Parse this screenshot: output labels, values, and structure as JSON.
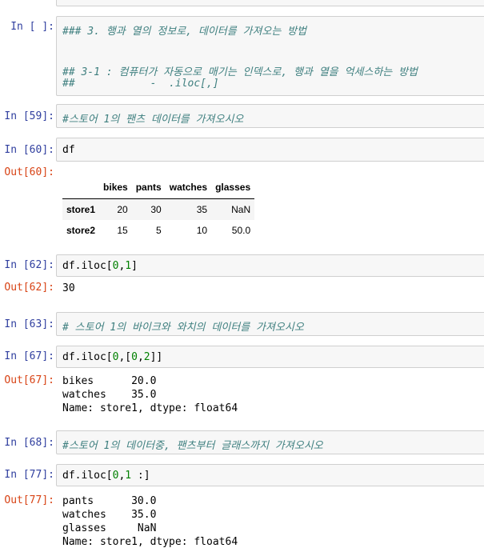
{
  "cells": [
    {
      "id": "c0",
      "prompt": "In [ ]:",
      "lines": [
        "### 3. 행과 열의 정보로, 데이터를 가져오는 방법",
        "",
        "",
        "## 3-1 : 컴퓨터가 자동으로 매기는 인덱스로, 행과 열을 억세스하는 방법",
        "##            -  .iloc[,]"
      ]
    },
    {
      "id": "c1",
      "prompt": "In [59]:",
      "code": "#스토어 1의 팬츠 데이터를 가져오시오"
    },
    {
      "id": "c2",
      "prompt": "In [60]:",
      "code": "df",
      "out_prompt": "Out[60]:"
    },
    {
      "id": "c3",
      "prompt": "In [62]:",
      "code": "df.iloc[0,1]",
      "out_prompt": "Out[62]:",
      "output": "30"
    },
    {
      "id": "c4",
      "prompt": "In [63]:",
      "code": "# 스토어 1의 바이크와 와치의 데이터를 가져오시오"
    },
    {
      "id": "c5",
      "prompt": "In [67]:",
      "code": "df.iloc[0,[0,2]]",
      "out_prompt": "Out[67]:",
      "output": "bikes      20.0\nwatches    35.0\nName: store1, dtype: float64"
    },
    {
      "id": "c6",
      "prompt": "In [68]:",
      "code": "#스토어 1의 데이터중, 팬츠부터 글래스까지 가져오시오"
    },
    {
      "id": "c7",
      "prompt": "In [77]:",
      "code": "df.iloc[0,1 :]",
      "out_prompt": "Out[77]:",
      "output": "pants      30.0\nwatches    35.0\nglasses     NaN\nName: store1, dtype: float64"
    }
  ],
  "dataframe": {
    "columns": [
      "",
      "bikes",
      "pants",
      "watches",
      "glasses"
    ],
    "rows": [
      [
        "store1",
        "20",
        "30",
        "35",
        "NaN"
      ],
      [
        "store2",
        "15",
        "5",
        "10",
        "50.0"
      ]
    ]
  }
}
